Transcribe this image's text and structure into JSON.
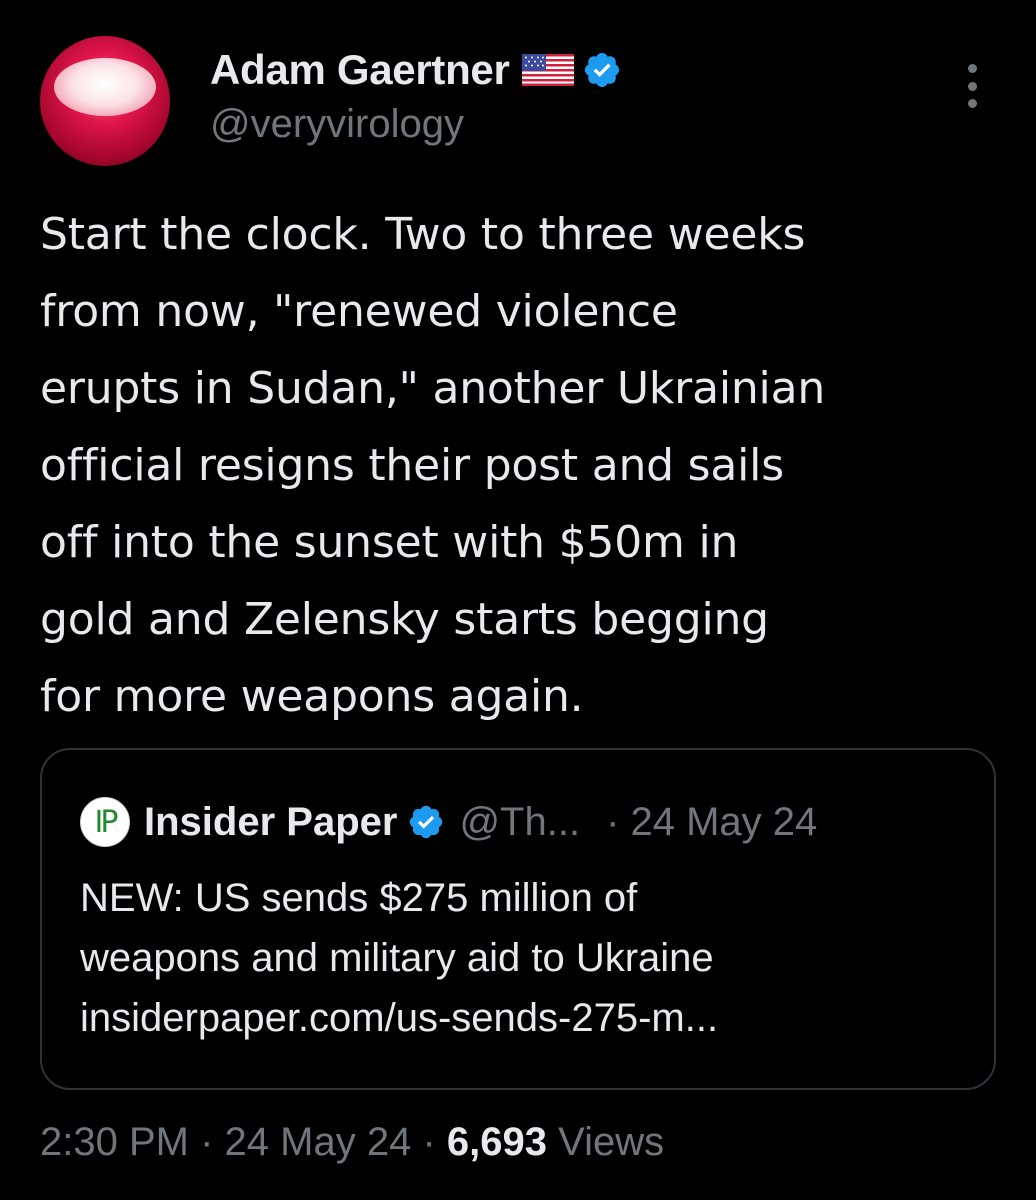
{
  "tweet": {
    "author": {
      "display_name": "Adam Gaertner",
      "handle": "@veryvirology",
      "flag_icon": "us-flag-icon",
      "verified_icon": "verified-badge-icon",
      "avatar": "avatar-image"
    },
    "more_icon": "more-options-icon",
    "text": "Start the clock. Two to three weeks\nfrom now, \"renewed violence\nerupts in Sudan,\" another Ukrainian\nofficial resigns their post and sails\noff into the sunset with $50m in\ngold and Zelensky starts begging\nfor more weapons again.",
    "quote": {
      "logo_text": "IP",
      "display_name": "Insider Paper",
      "handle": "@Th...",
      "date": "· 24 May 24",
      "text": "NEW: US sends $275 million of\nweapons and military aid to Ukraine\ninsiderpaper.com/us-sends-275-m..."
    },
    "footer": {
      "time": "2:30 PM",
      "separator": "·",
      "date": "24 May 24",
      "views_count": "6,693",
      "views_label": "Views"
    }
  },
  "colors": {
    "background": "#000000",
    "text_primary": "#e7e9ea",
    "text_secondary": "#71767b",
    "verified_blue": "#1d9bf0",
    "border": "#2f3336"
  }
}
